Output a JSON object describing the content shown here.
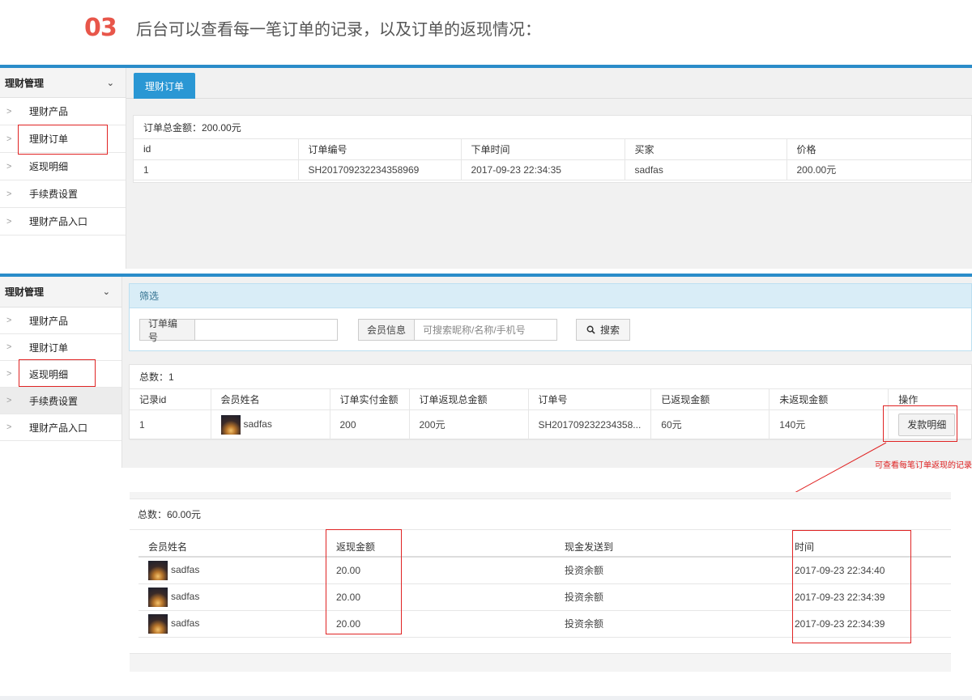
{
  "heading": {
    "number": "03",
    "text": "后台可以查看每一笔订单的记录，以及订单的返现情况："
  },
  "sidebar": {
    "title": "理财管理",
    "items": [
      {
        "label": "理财产品"
      },
      {
        "label": "理财订单"
      },
      {
        "label": "返现明细"
      },
      {
        "label": "手续费设置"
      },
      {
        "label": "理财产品入口"
      }
    ]
  },
  "panel1": {
    "tab": "理财订单",
    "total": "订单总金额：200.00元",
    "columns": [
      "id",
      "订单编号",
      "下单时间",
      "买家",
      "价格"
    ],
    "rows": [
      [
        "1",
        "SH201709232234358969",
        "2017-09-23 22:34:35",
        "sadfas",
        "200.00元"
      ]
    ]
  },
  "panel2": {
    "filter_title": "筛选",
    "order_no_label": "订单编号",
    "order_no_value": "",
    "member_label": "会员信息",
    "member_placeholder": "可搜索昵称/名称/手机号",
    "search_label": "搜索",
    "count": "总数：1",
    "columns": [
      "记录id",
      "会员姓名",
      "订单实付金额",
      "订单返现总金额",
      "订单号",
      "已返现金额",
      "未返现金额",
      "操作"
    ],
    "row": {
      "id": "1",
      "member": "sadfas",
      "paid": "200",
      "cashback_total": "200元",
      "order_no": "SH201709232234358...",
      "returned": "60元",
      "unreturned": "140元",
      "action": "发款明细"
    }
  },
  "annotation": "可查看每笔订单返现的记录",
  "panel3": {
    "total": "总数：60.00元",
    "columns": [
      "会员姓名",
      "返现金额",
      "现金发送到",
      "时间"
    ],
    "rows": [
      {
        "name": "sadfas",
        "amount": "20.00",
        "dest": "投资余额",
        "time": "2017-09-23 22:34:40"
      },
      {
        "name": "sadfas",
        "amount": "20.00",
        "dest": "投资余额",
        "time": "2017-09-23 22:34:39"
      },
      {
        "name": "sadfas",
        "amount": "20.00",
        "dest": "投资余额",
        "time": "2017-09-23 22:34:39"
      }
    ]
  },
  "colors": {
    "accent": "#2a97d4",
    "highlight": "#e02424"
  }
}
